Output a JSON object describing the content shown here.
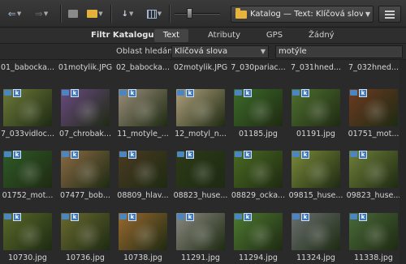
{
  "toolbar": {
    "path": "Katalog — Text: Klíčová slova — motýle"
  },
  "filter": {
    "label": "Filtr Katalogu:",
    "options": [
      "Text",
      "Atributy",
      "GPS",
      "Žádný"
    ],
    "active": "Text"
  },
  "search": {
    "area_label": "Oblast hledání:",
    "area_value": "Klíčová slova",
    "query": "motýle"
  },
  "grid": {
    "top_row": [
      "01_babocka...",
      "01motylik.JPG",
      "02_babocka...",
      "02motylik.JPG",
      "7_030pariac...",
      "7_031hned...",
      "7_032hned..."
    ],
    "rows": [
      {
        "captions": [
          "7_033vidloc...",
          "07_chrobak...",
          "11_motyle_...",
          "12_motyl_n...",
          "01185.jpg",
          "01191.jpg",
          "01751_mot..."
        ],
        "colors": [
          "#6d7a3a",
          "#6a4a82",
          "#9a8e7a",
          "#b0a17e",
          "#3d6b2a",
          "#4f7030",
          "#6c3a22"
        ]
      },
      {
        "captions": [
          "01752_mot...",
          "07477_bob...",
          "08809_hlav...",
          "08823_huse...",
          "08829_ocka...",
          "09815_huse...",
          "09823_huse..."
        ],
        "colors": [
          "#2f5a27",
          "#8a6a45",
          "#4a3a22",
          "#2c3a18",
          "#4a6a22",
          "#7a8a3a",
          "#6f7f3a"
        ]
      },
      {
        "captions": [
          "10730.jpg",
          "10736.jpg",
          "10738.jpg",
          "11291.jpg",
          "11294.jpg",
          "11324.jpg",
          "11338.jpg"
        ],
        "colors": [
          "#5a6a2a",
          "#6a6a30",
          "#9a6a30",
          "#8a8a80",
          "#4e7a32",
          "#6a7070",
          "#4a6a3a"
        ]
      }
    ]
  }
}
